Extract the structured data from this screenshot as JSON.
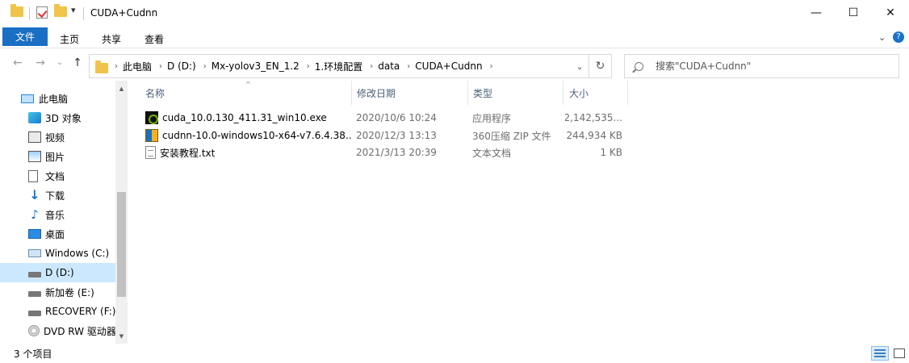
{
  "window": {
    "title": "CUDA+Cudnn",
    "minimize_glyph": "—",
    "maximize_glyph": "☐",
    "close_glyph": "✕"
  },
  "ribbon": {
    "tabs": [
      "文件",
      "主页",
      "共享",
      "查看"
    ],
    "collapse_glyph": "⌄",
    "help_glyph": "?"
  },
  "address": {
    "back_glyph": "←",
    "forward_glyph": "→",
    "history_glyph": "⌄",
    "up_glyph": "↑",
    "breadcrumbs": [
      "此电脑",
      "D (D:)",
      "Mx-yolov3_EN_1.2",
      "1.环境配置",
      "data",
      "CUDA+Cudnn"
    ],
    "crumb_sep": "›",
    "dropdown_glyph": "⌄",
    "refresh_glyph": "↻"
  },
  "search": {
    "placeholder": "搜索\"CUDA+Cudnn\""
  },
  "nav_pane": {
    "items": [
      {
        "label": "此电脑",
        "icon": "this-pc-icon"
      },
      {
        "label": "3D 对象",
        "icon": "3d-objects-icon"
      },
      {
        "label": "视频",
        "icon": "videos-icon"
      },
      {
        "label": "图片",
        "icon": "pictures-icon"
      },
      {
        "label": "文档",
        "icon": "documents-icon"
      },
      {
        "label": "下载",
        "icon": "downloads-icon"
      },
      {
        "label": "音乐",
        "icon": "music-icon"
      },
      {
        "label": "桌面",
        "icon": "desktop-icon"
      },
      {
        "label": "Windows (C:)",
        "icon": "drive-c-icon"
      },
      {
        "label": "D (D:)",
        "icon": "drive-d-icon",
        "selected": true
      },
      {
        "label": "新加卷 (E:)",
        "icon": "drive-e-icon"
      },
      {
        "label": "RECOVERY (F:)",
        "icon": "drive-f-icon"
      },
      {
        "label": "DVD RW 驱动器",
        "icon": "dvd-drive-icon"
      }
    ],
    "scroll_up_glyph": "▲",
    "scroll_down_glyph": "▼"
  },
  "columns": {
    "name": "名称",
    "date": "修改日期",
    "type": "类型",
    "size": "大小",
    "sort_glyph": "^"
  },
  "files": [
    {
      "name": "cuda_10.0.130_411.31_win10.exe",
      "date": "2020/10/6 10:24",
      "type": "应用程序",
      "size": "2,142,535...",
      "icon": "exe-icon"
    },
    {
      "name": "cudnn-10.0-windows10-x64-v7.6.4.38....",
      "date": "2020/12/3 13:13",
      "type": "360压缩 ZIP 文件",
      "size": "244,934 KB",
      "icon": "zip-icon"
    },
    {
      "name": "安装教程.txt",
      "date": "2021/3/13 20:39",
      "type": "文本文档",
      "size": "1 KB",
      "icon": "txt-icon"
    }
  ],
  "status": {
    "item_count": "3 个项目"
  },
  "colors": {
    "accent": "#1a6fc4",
    "selection": "#cce8ff"
  }
}
